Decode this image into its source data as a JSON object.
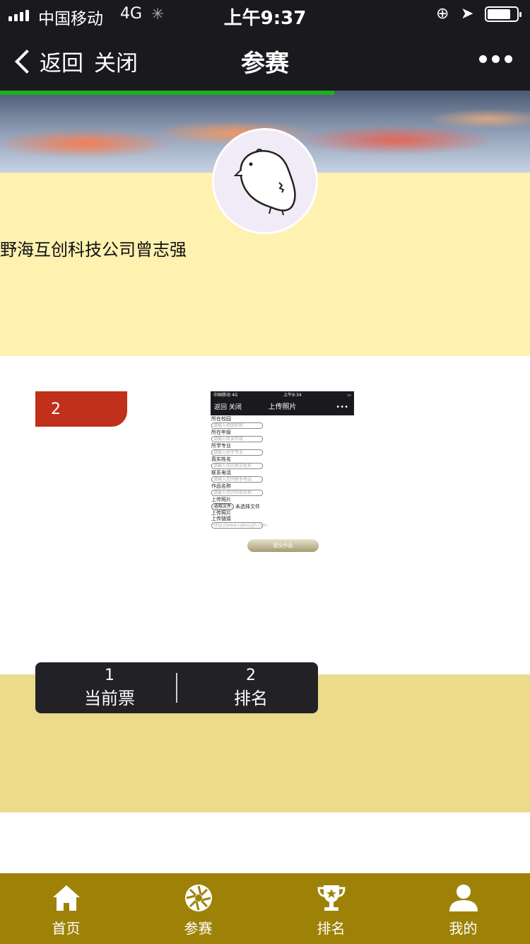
{
  "status_bar": {
    "carrier": "中国移动",
    "network": "4G",
    "time": "上午9:37",
    "battery_level": 0.75
  },
  "nav": {
    "back_label": "返回",
    "close_label": "关闭",
    "title": "参赛",
    "more_icon": "more-dots-icon",
    "load_progress": 0.63
  },
  "profile": {
    "name": "野海互创科技公司曾志强"
  },
  "entry": {
    "rank_badge": "2",
    "screenshot": {
      "status_carrier": "中国移动  4G",
      "status_time": "上午9:34",
      "nav_back": "返回  关闭",
      "nav_title": "上传照片",
      "nav_more": "•••",
      "fields": [
        {
          "label": "所在校园",
          "placeholder": "请输入校园名称"
        },
        {
          "label": "所在年级",
          "placeholder": "请输入就读年级"
        },
        {
          "label": "所学专业",
          "placeholder": "请输入所学专业"
        },
        {
          "label": "真实姓名",
          "placeholder": "请输入您的真实姓名"
        },
        {
          "label": "联系电话",
          "placeholder": "请输入您的联系电话"
        },
        {
          "label": "作品名称",
          "placeholder": "请输入您的作品名称"
        }
      ],
      "upload_label": "上传照片",
      "file_button": "选取文件",
      "file_status": "未选择文件",
      "upload_label_2": "上传照片",
      "link_label": "上传链接",
      "link_placeholder": "http://www.cqbxzyjh.com",
      "submit": "提交作品"
    }
  },
  "stats": {
    "votes_value": "1",
    "votes_label": "当前票",
    "rank_value": "2",
    "rank_label": "排名"
  },
  "tabbar": {
    "items": [
      {
        "label": "首页",
        "icon": "home-icon"
      },
      {
        "label": "参赛",
        "icon": "aperture-icon"
      },
      {
        "label": "排名",
        "icon": "trophy-icon"
      },
      {
        "label": "我的",
        "icon": "user-icon"
      }
    ]
  },
  "colors": {
    "nav_bg": "#1a1a1e",
    "progress": "#1db01d",
    "hero_body": "#fff1b0",
    "rank_badge": "#c0301a",
    "band": "#ebdb8a",
    "tabbar": "#9e8208"
  }
}
